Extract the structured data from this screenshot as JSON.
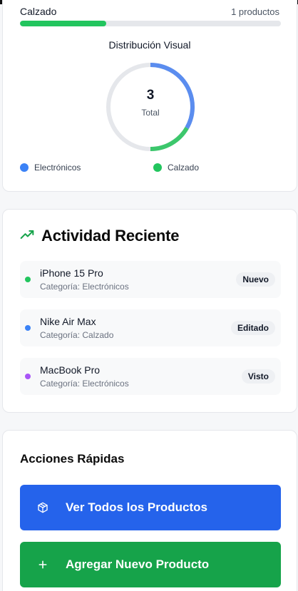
{
  "category": {
    "name": "Calzado",
    "count_text": "1 productos",
    "progress_percent": 33,
    "bar_color": "#22c55e"
  },
  "distribution": {
    "title": "Distribución Visual",
    "total_value": "3",
    "total_label": "Total",
    "segments": [
      {
        "name": "Electrónicos",
        "value": 2,
        "color": "#5b8def"
      },
      {
        "name": "Calzado",
        "value": 1,
        "color": "#3cc76c"
      }
    ],
    "legend": [
      {
        "label": "Electrónicos",
        "color": "#3b82f6"
      },
      {
        "label": "Calzado",
        "color": "#22c55e"
      }
    ]
  },
  "activity": {
    "title": "Actividad Reciente",
    "icon": "trending-up-icon",
    "items": [
      {
        "name": "iPhone 15 Pro",
        "category": "Categoría: Electrónicos",
        "badge": "Nuevo",
        "dot_color": "#22c55e"
      },
      {
        "name": "Nike Air Max",
        "category": "Categoría: Calzado",
        "badge": "Editado",
        "dot_color": "#3b82f6"
      },
      {
        "name": "MacBook Pro",
        "category": "Categoría: Electrónicos",
        "badge": "Visto",
        "dot_color": "#a855f7"
      }
    ]
  },
  "quick_actions": {
    "title": "Acciones Rápidas",
    "view_all_label": "Ver Todos los Productos",
    "view_all_icon": "package-icon",
    "view_all_color": "#2563eb",
    "add_label": "Agregar Nuevo Producto",
    "add_icon": "plus-icon",
    "add_color": "#16a34a"
  }
}
